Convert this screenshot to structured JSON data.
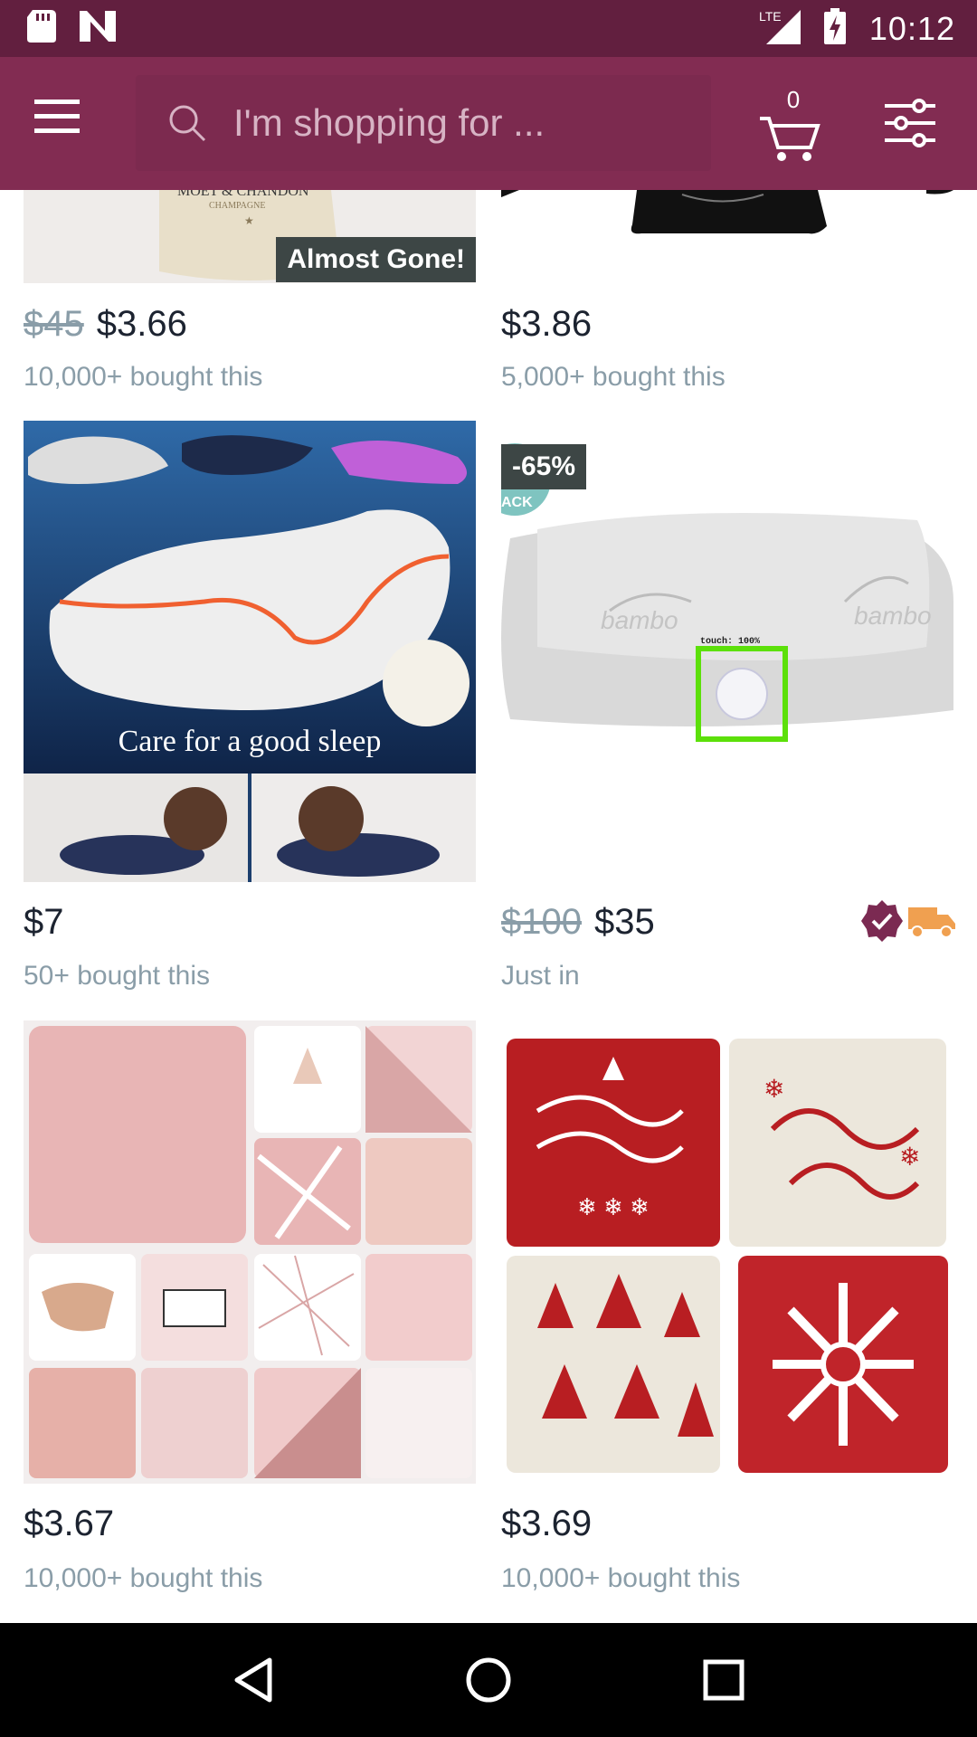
{
  "status_bar": {
    "time": "10:12",
    "network": "LTE",
    "icons": [
      "sd-card-icon",
      "n-logo-icon",
      "signal-icon",
      "battery-charging-icon"
    ]
  },
  "app_bar": {
    "menu_icon": "hamburger-menu-icon",
    "search_placeholder": "I'm shopping for ...",
    "cart_count": "0",
    "filter_icon": "sliders-filter-icon"
  },
  "products": [
    {
      "old_price": "$45",
      "price": "$3.66",
      "sub": "10,000+ bought this",
      "badge": "Almost Gone!"
    },
    {
      "old_price": "",
      "price": "$3.86",
      "sub": "5,000+ bought this",
      "badge": ""
    },
    {
      "old_price": "",
      "price": "$7",
      "sub": "50+ bought this",
      "badge": "",
      "image_caption": "Care for a good sleep"
    },
    {
      "old_price": "$100",
      "price": "$35",
      "sub": "Just in",
      "badge": "-65%",
      "touch_label": "touch: 100%"
    },
    {
      "old_price": "",
      "price": "$3.67",
      "sub": "10,000+ bought this",
      "badge": ""
    },
    {
      "old_price": "",
      "price": "$3.69",
      "sub": "10,000+ bought this",
      "badge": ""
    }
  ],
  "colors": {
    "status_bar": "#621f3f",
    "app_bar": "#822c52",
    "price_text": "#1c2330",
    "muted_text": "#8a9da8",
    "badge_bg": "#3d4645",
    "verified_badge": "#7b2a52",
    "shipping_truck": "#f0a050"
  },
  "nav_bar": {
    "icons": [
      "back-triangle-icon",
      "home-circle-icon",
      "recents-square-icon"
    ]
  }
}
